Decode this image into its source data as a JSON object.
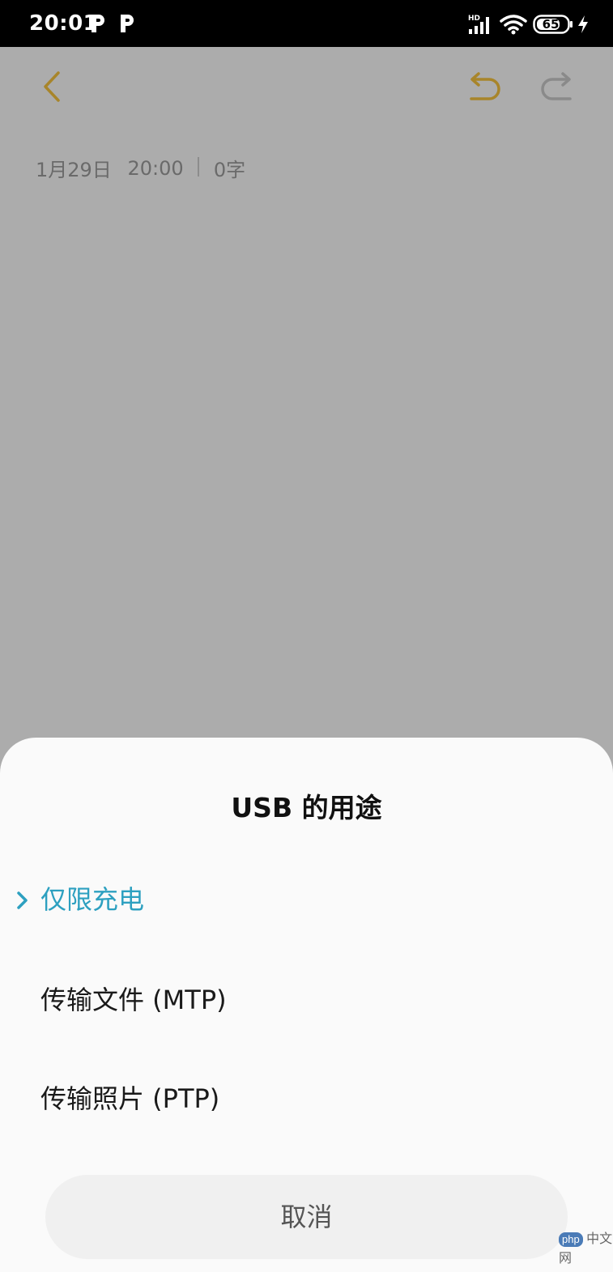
{
  "status_bar": {
    "time": "20:01",
    "battery_level": "65",
    "indicators": [
      "p-notification-icon",
      "p-notification-icon",
      "hd-signal-icon",
      "wifi-icon",
      "battery-icon",
      "charging-bolt-icon"
    ]
  },
  "toolbar": {
    "back_icon": "chevron-left-icon",
    "undo_icon": "undo-icon",
    "redo_icon": "redo-icon",
    "accent_color": "#c9a227"
  },
  "note": {
    "date": "1月29日",
    "time": "20:00",
    "word_count": "0字"
  },
  "sheet": {
    "title": "USB 的用途",
    "options": [
      {
        "label": "仅限充电",
        "selected": true
      },
      {
        "label": "传输文件 (MTP)",
        "selected": false
      },
      {
        "label": "传输照片 (PTP)",
        "selected": false
      }
    ],
    "cancel_label": "取消",
    "selected_color": "#2da0c0"
  },
  "watermark": {
    "text": "中文网",
    "badge": "php"
  }
}
